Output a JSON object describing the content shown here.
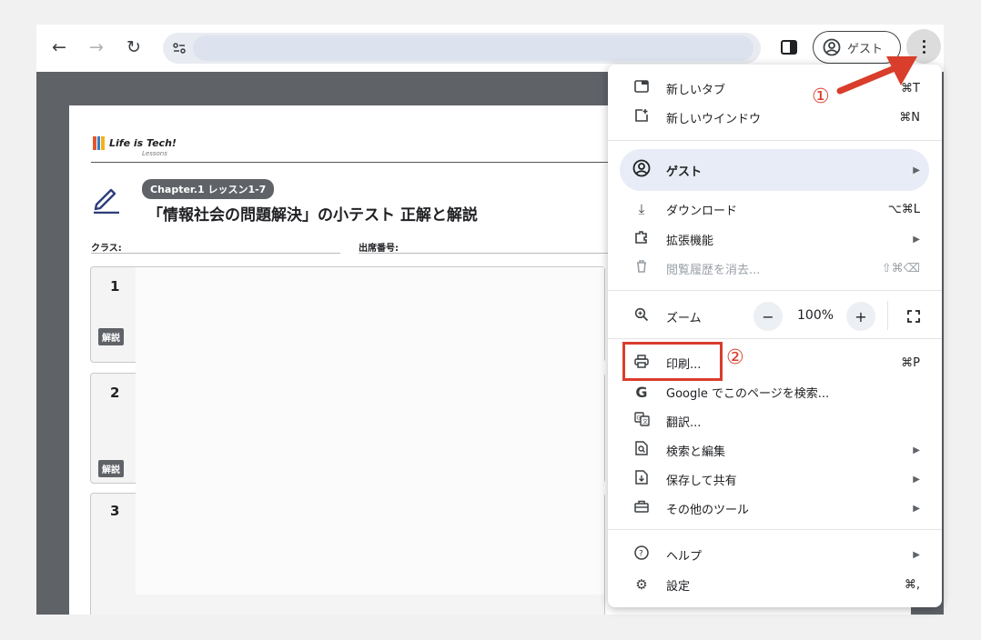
{
  "toolbar": {
    "back_icon": "arrow-left-icon",
    "forward_icon": "arrow-right-icon",
    "reload_icon": "reload-icon",
    "site_settings_icon": "tune-icon",
    "url": "",
    "side_panel_icon": "side-panel-icon",
    "profile_label": "ゲスト",
    "menu_icon": "three-dots-vertical-icon"
  },
  "document": {
    "logo_text": "Life is Tech!",
    "logo_sub": "Lessons",
    "chapter_badge": "Chapter.1 レッスン1-7",
    "title": "「情報社会の問題解決」の小テスト 正解と解説",
    "class_label": "クラス:",
    "seat_label": "出席番号:",
    "questions": [
      {
        "number": "1",
        "badge": "解説"
      },
      {
        "number": "2",
        "badge": "解説"
      },
      {
        "number": "3",
        "badge": ""
      }
    ]
  },
  "menu": {
    "new_tab": {
      "label": "新しいタブ",
      "shortcut": "⌘T"
    },
    "new_window": {
      "label": "新しいウインドウ",
      "shortcut": "⌘N"
    },
    "guest": {
      "label": "ゲスト"
    },
    "downloads": {
      "label": "ダウンロード",
      "shortcut": "⌥⌘L"
    },
    "extensions": {
      "label": "拡張機能"
    },
    "clear_history": {
      "label": "閲覧履歴を消去...",
      "shortcut": "⇧⌘⌫"
    },
    "zoom": {
      "label": "ズーム",
      "minus": "−",
      "value": "100%",
      "plus": "+"
    },
    "print": {
      "label": "印刷...",
      "shortcut": "⌘P"
    },
    "google_search": {
      "label": "Google でこのページを検索..."
    },
    "translate": {
      "label": "翻訳..."
    },
    "search_edit": {
      "label": "検索と編集"
    },
    "save_share": {
      "label": "保存して共有"
    },
    "more_tools": {
      "label": "その他のツール"
    },
    "help": {
      "label": "ヘルプ"
    },
    "settings": {
      "label": "設定",
      "shortcut": "⌘,"
    }
  },
  "annotations": {
    "step1": "①",
    "step2": "②",
    "color": "#d93d2b"
  }
}
